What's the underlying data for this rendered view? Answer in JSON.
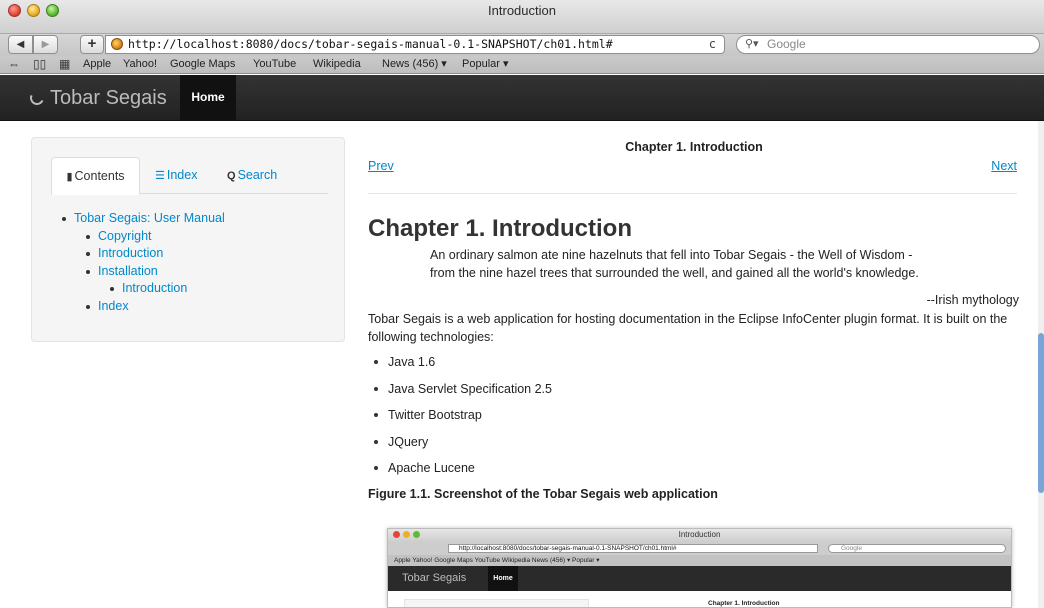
{
  "window": {
    "title": "Introduction"
  },
  "toolbar": {
    "back_label": "◀",
    "forward_label": "▶",
    "add_label": "+",
    "url": "http://localhost:8080/docs/tobar-segais-manual-0.1-SNAPSHOT/ch01.html#",
    "reload_label": "c",
    "search_placeholder": "Google",
    "search_icon": "magnifier-icon"
  },
  "bookmarks": {
    "items": [
      "Apple",
      "Yahoo!",
      "Google Maps",
      "YouTube",
      "Wikipedia",
      "News (456) ▾",
      "Popular ▾"
    ]
  },
  "navbar": {
    "brand": "Tobar Segais",
    "home": "Home"
  },
  "sidebar": {
    "tabs": [
      {
        "label": "Contents",
        "icon": "book-icon"
      },
      {
        "label": "Index",
        "icon": "list-icon"
      },
      {
        "label": "Search",
        "icon": "search-icon"
      }
    ],
    "toc": [
      {
        "label": "Tobar Segais: User Manual",
        "level": 0
      },
      {
        "label": "Copyright",
        "level": 1
      },
      {
        "label": "Introduction",
        "level": 1
      },
      {
        "label": "Installation",
        "level": 1
      },
      {
        "label": "Introduction",
        "level": 2
      },
      {
        "label": "Index",
        "level": 1
      }
    ]
  },
  "content": {
    "header": "Chapter 1. Introduction",
    "prev": "Prev",
    "next": "Next",
    "heading": "Chapter 1. Introduction",
    "epigraph_line1": "An ordinary salmon ate nine hazelnuts that fell into Tobar Segais - the Well of Wisdom -",
    "epigraph_line2": "from the nine hazel trees that surrounded the well, and gained all the world's knowledge.",
    "attribution": "--Irish mythology",
    "paragraph": "Tobar Segais is a web application for hosting documentation in the Eclipse InfoCenter plugin format. It is built on the following technologies:",
    "technologies": [
      "Java 1.6",
      "Java Servlet Specification 2.5",
      "Twitter Bootstrap",
      "JQuery",
      "Apache Lucene"
    ],
    "figure_title": "Figure 1.1. Screenshot of the Tobar Segais web application"
  },
  "screenshot": {
    "window_title": "Introduction",
    "url": "http://localhost:8080/docs/tobar-segais-manual-0.1-SNAPSHOT/ch01.html#",
    "search_placeholder": "Google",
    "bookmarks": "Apple   Yahoo!   Google Maps   YouTube   Wikipedia   News (456) ▾   Popular ▾",
    "brand": "Tobar Segais",
    "home": "Home",
    "chapter": "Chapter 1. Introduction"
  },
  "colors": {
    "link": "#0088cc",
    "navbar": "#222222",
    "accent_scroll": "#7aa3d8"
  }
}
